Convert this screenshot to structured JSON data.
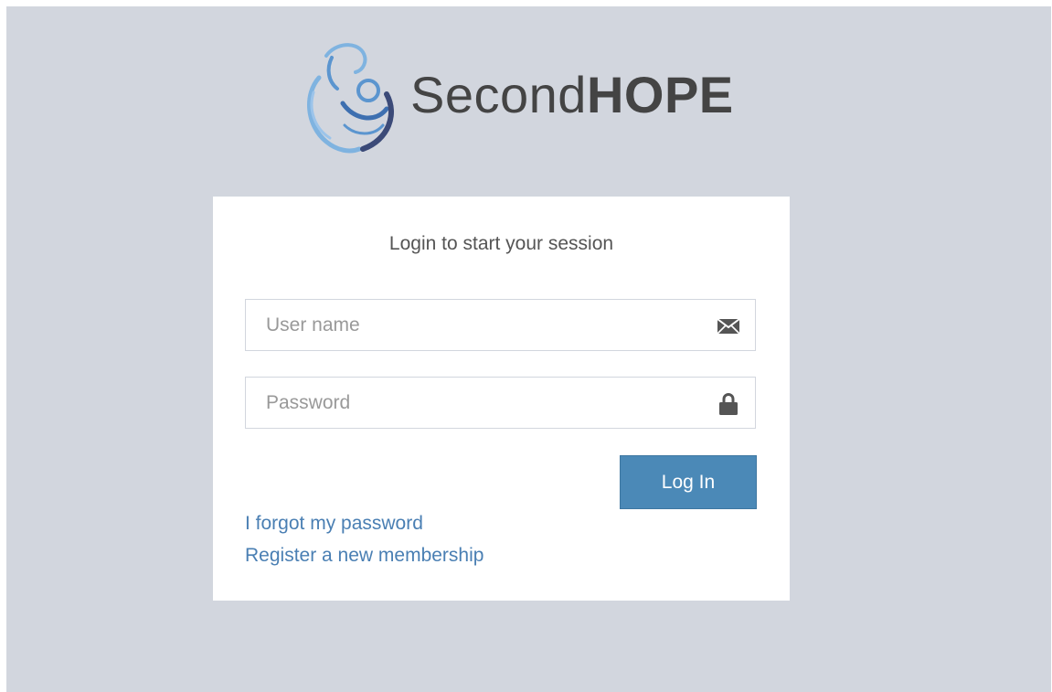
{
  "brand": {
    "name_light": "Second",
    "name_bold": "HOPE",
    "logo_icon": "mother-child-logo-icon",
    "colors": {
      "logo_blue_light": "#7fb3e0",
      "logo_blue_dark": "#3d6fb0",
      "logo_navy": "#3b4a78",
      "text": "#444444"
    }
  },
  "login": {
    "message": "Login to start your session",
    "username": {
      "value": "",
      "placeholder": "User name",
      "icon": "envelope-icon"
    },
    "password": {
      "value": "",
      "placeholder": "Password",
      "icon": "lock-icon"
    },
    "submit_label": "Log In",
    "forgot_link": "I forgot my password",
    "register_link": "Register a new membership"
  },
  "colors": {
    "page_background": "#d2d6de",
    "box_background": "#ffffff",
    "button": "#4b89b7",
    "link": "#4a7fb3"
  }
}
